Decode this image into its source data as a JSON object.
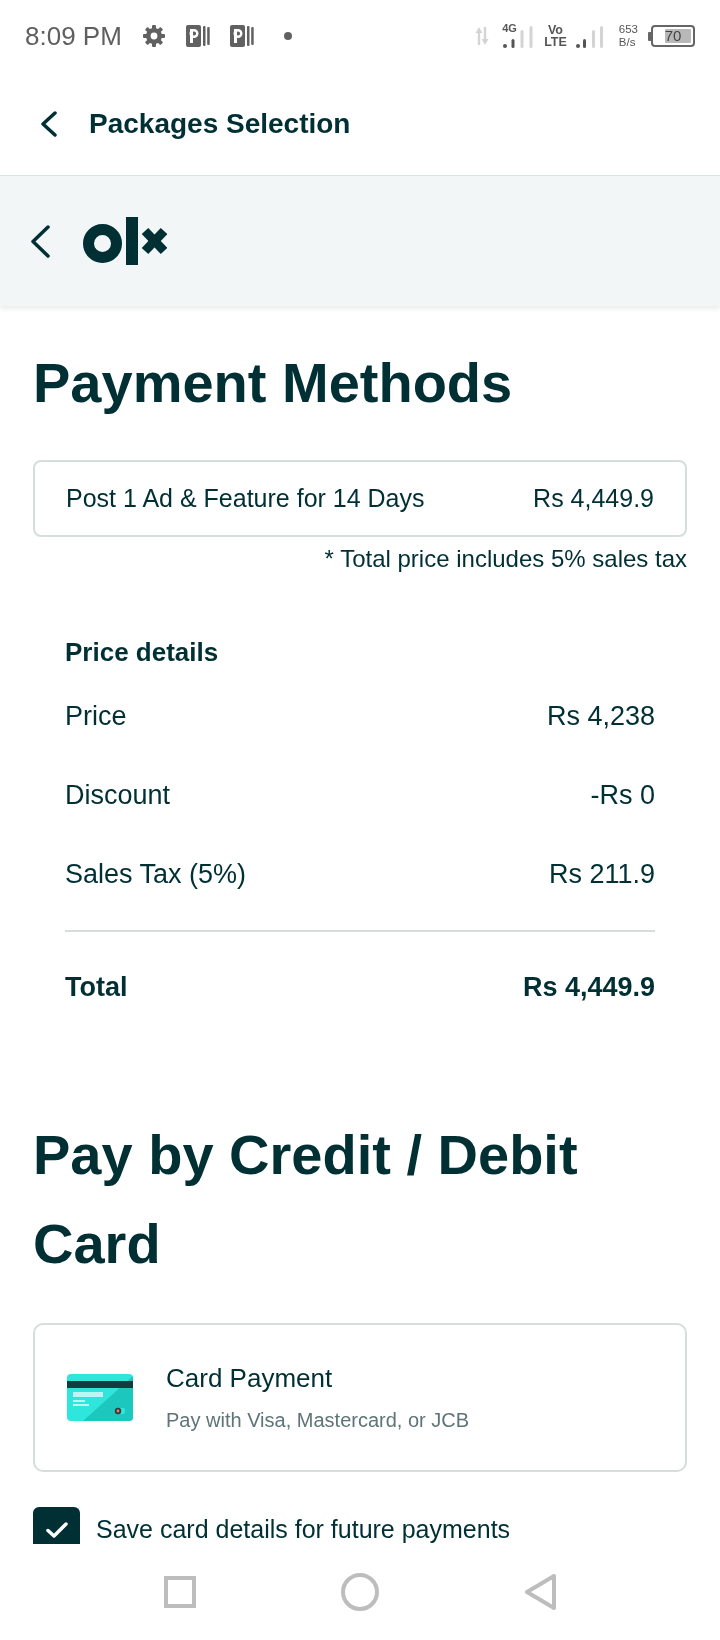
{
  "status_bar": {
    "time": "8:09 PM",
    "network_label": "4G",
    "volte": [
      "Vo",
      "LTE"
    ],
    "speed": [
      "653",
      "B/s"
    ],
    "battery": "70"
  },
  "header": {
    "title": "Packages Selection"
  },
  "page_title": "Payment Methods",
  "package": {
    "name": "Post 1 Ad & Feature for 14 Days",
    "price": "Rs 4,449.9",
    "note": "* Total price includes 5% sales tax"
  },
  "price_details": {
    "title": "Price details",
    "rows": [
      {
        "kind": "line",
        "label": "Price",
        "value": "Rs 4,238"
      },
      {
        "kind": "line",
        "label": "Discount",
        "value": "-Rs 0"
      },
      {
        "kind": "line",
        "label": "Sales Tax (5%)",
        "value": "Rs 211.9"
      },
      {
        "kind": "total",
        "label": "Total",
        "value": "Rs 4,449.9"
      }
    ]
  },
  "card_section": {
    "title": "Pay by Credit / Debit Card",
    "method": {
      "title": "Card Payment",
      "subtitle": "Pay with Visa, Mastercard, or JCB"
    },
    "save_card": {
      "label": "Save card details for future payments",
      "checked": true
    }
  }
}
